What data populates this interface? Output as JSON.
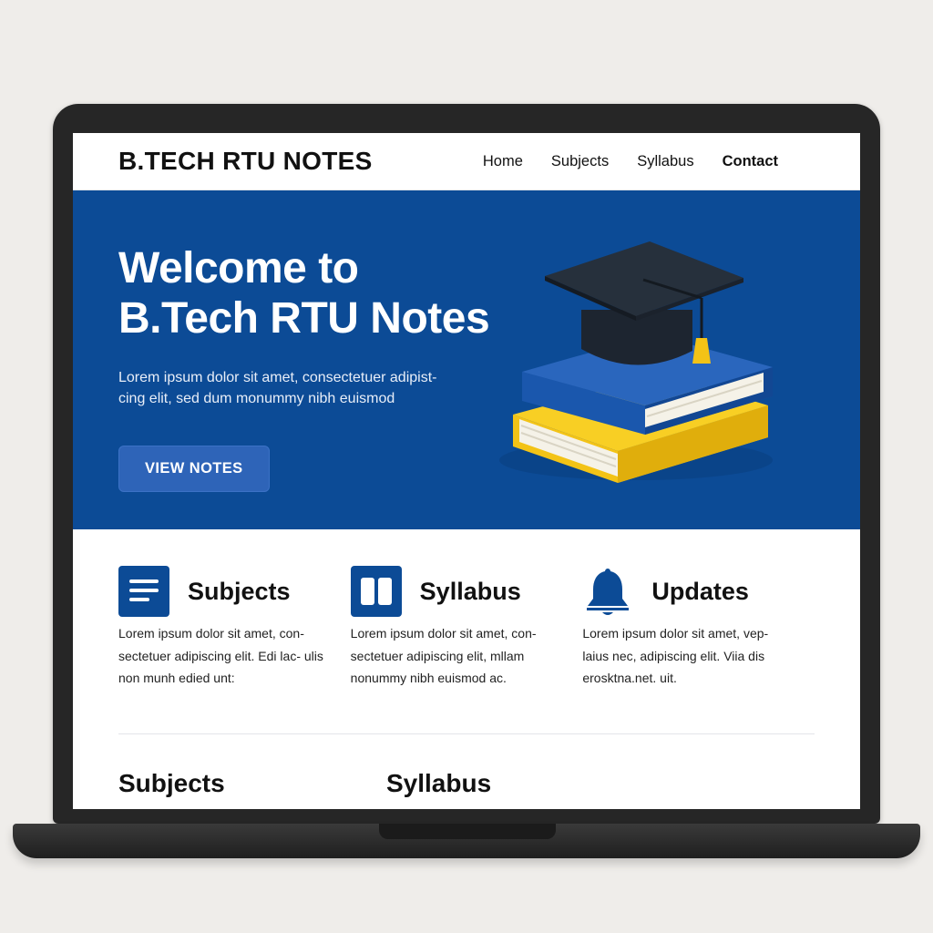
{
  "site": {
    "brand": "B.TECH RTU NOTES"
  },
  "nav": {
    "items": [
      {
        "label": "Home"
      },
      {
        "label": "Subjects"
      },
      {
        "label": "Syllabus"
      },
      {
        "label": "Contact"
      }
    ]
  },
  "hero": {
    "title_line1": "Welcome to",
    "title_line2": "B.Tech RTU Notes",
    "description": "Lorem ipsum dolor sit amet, consectetuer adipist- cing elit, sed dum monummy nibh euismod",
    "button_label": "VIEW NOTES",
    "illustration": "graduation-cap-on-books"
  },
  "features": [
    {
      "icon": "document-lines-icon",
      "title": "Subjects",
      "text": "Lorem ipsum dolor sit amet, con- sectetuer adipiscing elit. Edi lac- ulis non munh edied unt:"
    },
    {
      "icon": "book-icon",
      "title": "Syllabus",
      "text": "Lorem ipsum dolor sit amet, con- sectetuer adipiscing elit, mllam nonummy nibh euismod ac."
    },
    {
      "icon": "bell-icon",
      "title": "Updates",
      "text": "Lorem ipsum dolor sit amet, vep- laius nec, adipiscing elit. Viia dis erosktna.net. uit."
    }
  ],
  "sections": {
    "subjects_heading": "Subjects",
    "syllabus_heading": "Syllabus"
  },
  "colors": {
    "primary": "#0c4b96",
    "button": "#2e64b8",
    "accent": "#f5c518",
    "background": "#efedea"
  }
}
